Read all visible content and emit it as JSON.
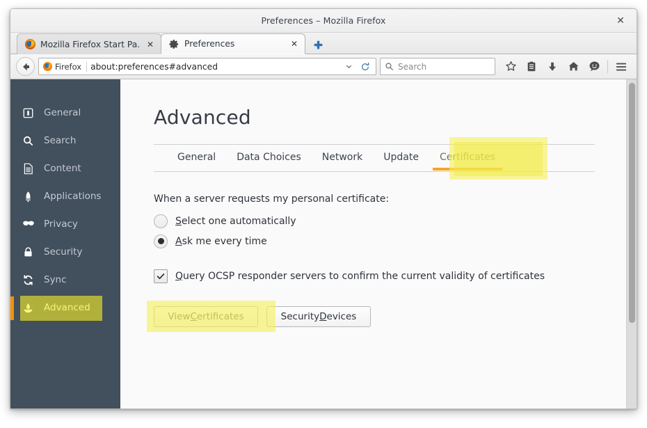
{
  "window": {
    "title": "Preferences – Mozilla Firefox",
    "close_label": "✕"
  },
  "browser_tabs": [
    {
      "label": "Mozilla Firefox Start Pa...",
      "close_label": "✕",
      "icon": "firefox-logo-icon",
      "active": false
    },
    {
      "label": "Preferences",
      "close_label": "✕",
      "icon": "gear-icon",
      "active": true
    }
  ],
  "newtab": {
    "label": "+",
    "icon": "plus-icon"
  },
  "toolbar": {
    "back_icon": "back-arrow-icon",
    "identity_label": "Firefox",
    "url": "about:preferences#advanced",
    "dropdown_icon": "chevron-down-icon",
    "reload_icon": "reload-icon",
    "search_placeholder": "Search",
    "search_value": "",
    "search_icon": "magnifier-icon",
    "icons": [
      {
        "name": "bookmark-star-icon",
        "glyph": "☆"
      },
      {
        "name": "reader-list-icon",
        "glyph": "▤"
      },
      {
        "name": "downloads-icon",
        "glyph": "⬇"
      },
      {
        "name": "home-icon",
        "glyph": "⌂"
      },
      {
        "name": "feedback-smiley-icon",
        "glyph": "☻"
      },
      {
        "name": "menu-hamburger-icon",
        "glyph": "☰"
      }
    ]
  },
  "sidebar": {
    "items": [
      {
        "label": "General",
        "icon": "general-icon",
        "selected": false
      },
      {
        "label": "Search",
        "icon": "search-icon",
        "selected": false
      },
      {
        "label": "Content",
        "icon": "content-icon",
        "selected": false
      },
      {
        "label": "Applications",
        "icon": "applications-icon",
        "selected": false
      },
      {
        "label": "Privacy",
        "icon": "privacy-mask-icon",
        "selected": false
      },
      {
        "label": "Security",
        "icon": "security-lock-icon",
        "selected": false
      },
      {
        "label": "Sync",
        "icon": "sync-icon",
        "selected": false
      },
      {
        "label": "Advanced",
        "icon": "advanced-icon",
        "selected": true
      }
    ]
  },
  "main": {
    "title": "Advanced",
    "tabs": [
      {
        "label": "General",
        "current": false
      },
      {
        "label": "Data Choices",
        "current": false
      },
      {
        "label": "Network",
        "current": false
      },
      {
        "label": "Update",
        "current": false
      },
      {
        "label": "Certificates",
        "current": true
      }
    ],
    "certificates": {
      "section_label": "When a server requests my personal certificate:",
      "radios": [
        {
          "label_pre": "",
          "label_key": "S",
          "label_post": "elect one automatically",
          "selected": false
        },
        {
          "label_pre": "",
          "label_key": "A",
          "label_post": "sk me every time",
          "selected": true
        }
      ],
      "checkbox": {
        "label_pre": "",
        "label_key": "Q",
        "label_post": "uery OCSP responder servers to confirm the current validity of certificates",
        "checked": true,
        "check_glyph": "✓"
      },
      "buttons": [
        {
          "label_pre": "View ",
          "label_key": "C",
          "label_post": "ertificates",
          "highlighted": true
        },
        {
          "label_pre": "Security ",
          "label_key": "D",
          "label_post": "evices",
          "highlighted": false
        }
      ]
    }
  },
  "colors": {
    "sidebar_bg": "#424f5c",
    "selection_orange": "#f59100",
    "tab_underline": "#f5a623",
    "highlight_yellow": "#f6f05a",
    "content_bg": "#fafafa",
    "text_dark": "#2e333a"
  }
}
